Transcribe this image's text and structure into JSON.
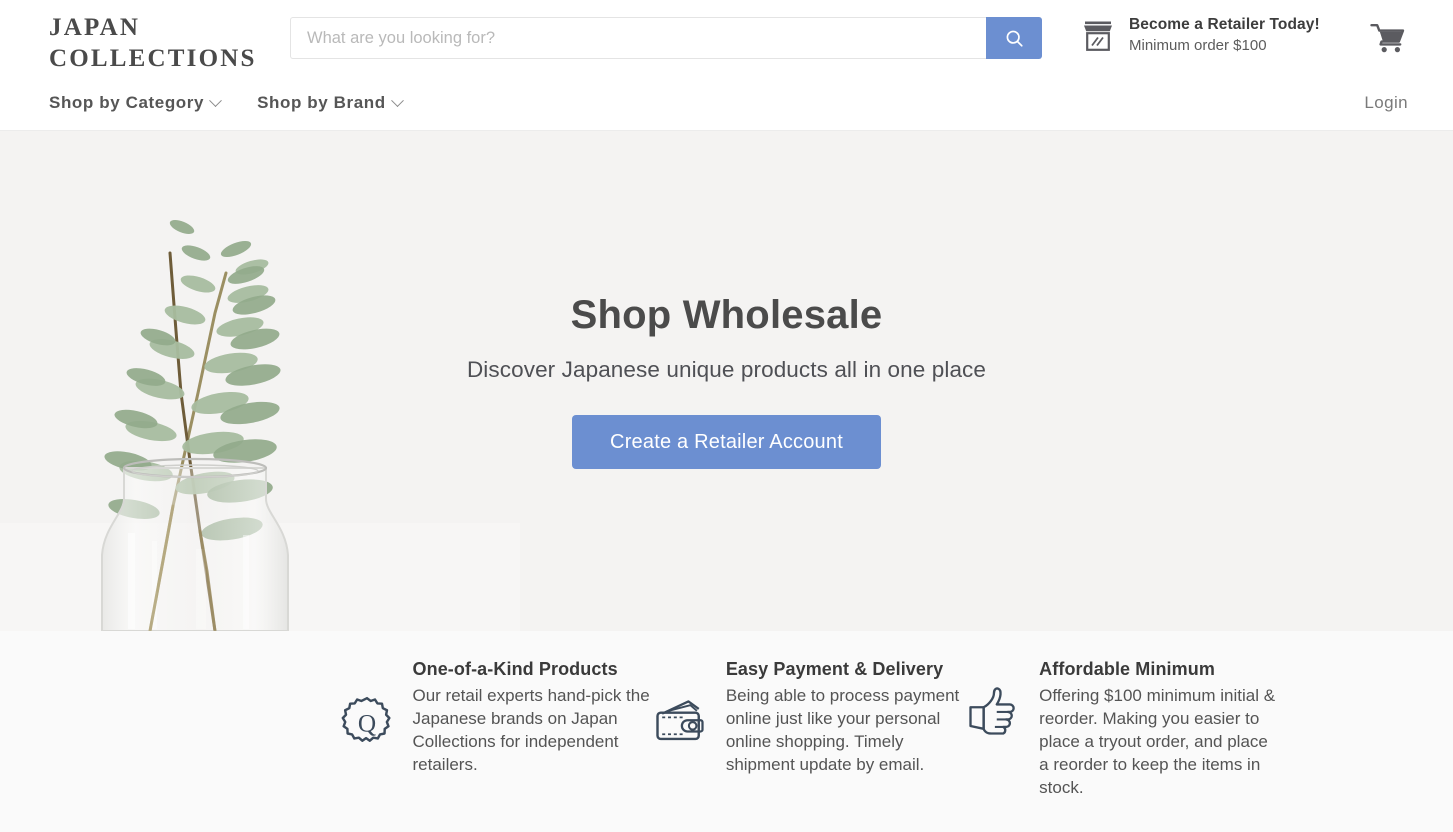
{
  "header": {
    "logo_line1": "JAPAN",
    "logo_line2": "COLLECTIONS",
    "search_placeholder": "What are you looking for?",
    "search_value": "",
    "search_icon": "search-icon",
    "store_icon": "storefront-icon",
    "cart_icon": "shopping-cart-icon",
    "retailer_title": "Become a Retailer Today!",
    "retailer_sub": "Minimum order $100"
  },
  "nav": {
    "items": [
      {
        "label": "Shop by Category",
        "caret": "chevron-down-icon"
      },
      {
        "label": "Shop by Brand",
        "caret": "chevron-down-icon"
      }
    ],
    "login": "Login"
  },
  "hero": {
    "title": "Shop Wholesale",
    "subtitle": "Discover Japanese unique products all in one place",
    "cta": "Create a Retailer Account",
    "art": "eucalyptus-in-glass-vase"
  },
  "features": [
    {
      "icon": "quality-badge-icon",
      "title": "One-of-a-Kind Products",
      "text": "Our retail experts hand-pick the Japanese brands on Japan Collections for independent retailers."
    },
    {
      "icon": "wallet-icon",
      "title": "Easy Payment & Delivery",
      "text": "Being able to process payment online just like your personal online shopping. Timely shipment update by email."
    },
    {
      "icon": "thumbs-up-icon",
      "title": "Affordable Minimum",
      "text": "Offering $100 minimum initial & reorder. Making you easier to place a tryout order, and place a reorder to keep the items in stock."
    }
  ],
  "colors": {
    "accent_blue": "#6c8fd1",
    "hero_bg": "#f4f3f2",
    "features_bg": "#fafafa",
    "icon_slate": "#3c4b5c",
    "text_dark": "#4a4a4a"
  }
}
